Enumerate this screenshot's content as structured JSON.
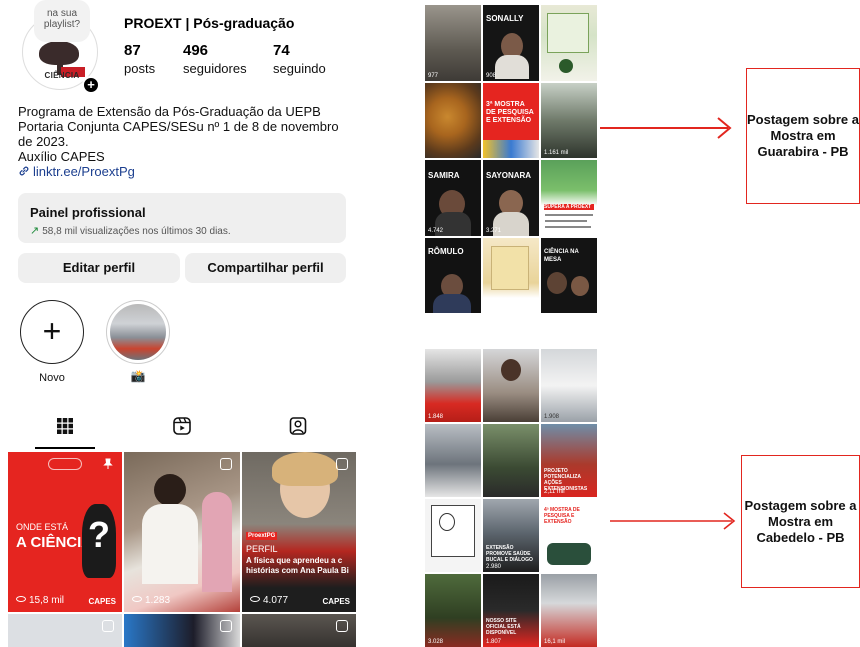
{
  "profile": {
    "username": "PROEXT | Pós-graduação",
    "note": "na sua playlist?",
    "logo_text": "CIÊNCIA",
    "stats": [
      {
        "value": "87",
        "label": "posts"
      },
      {
        "value": "496",
        "label": "seguidores"
      },
      {
        "value": "74",
        "label": "seguindo"
      }
    ],
    "bio": {
      "line1": "Programa de Extensão da Pós-Graduação da UEPB",
      "line2": "Portaria Conjunta CAPES/SESu nº 1 de 8 de novembro",
      "line3": "de 2023.",
      "line4": "Auxílio CAPES",
      "link": "linktr.ee/ProextPg"
    },
    "pro_panel": {
      "title": "Painel profissional",
      "subtitle": "58,8 mil visualizações nos últimos 30 dias."
    },
    "buttons": {
      "edit": "Editar perfil",
      "share": "Compartilhar perfil"
    },
    "highlights": [
      {
        "label": "Novo"
      },
      {
        "label": "📸"
      }
    ],
    "tabs": [
      "grid-icon",
      "reels-icon",
      "tagged-icon"
    ],
    "posts": [
      {
        "line1": "ONDE ESTÁ",
        "line2": "A CIÊNCIA",
        "mark": "?",
        "views": "15,8 mil",
        "capes": "CAPES"
      },
      {
        "views": "1.283"
      },
      {
        "tag": "ProextPG",
        "line1": "PERFIL",
        "line2": "A física que aprendeu a c",
        "line3": "histórias com Ana Paula Bi",
        "views": "4.077",
        "capes": "CAPES"
      }
    ]
  },
  "collage_top": {
    "cells": [
      {
        "text": "",
        "views": "977"
      },
      {
        "text": "SONALLY",
        "views": "908"
      },
      {
        "text": "",
        "views": ""
      },
      {
        "text": "",
        "views": ""
      },
      {
        "text": "3ª MOSTRA DE PESQUISA E EXTENSÃO",
        "views": ""
      },
      {
        "text": "",
        "views": "1.161 mil"
      },
      {
        "text": "SAMIRA",
        "views": "4.742"
      },
      {
        "text": "SAYONARA",
        "views": "3.271"
      },
      {
        "text": "SUPERA A PROEXT",
        "views": ""
      },
      {
        "text": "RÔMULO",
        "views": ""
      },
      {
        "text": "",
        "views": ""
      },
      {
        "text": "CIÊNCIA NA MESA",
        "views": ""
      }
    ]
  },
  "collage_bottom": {
    "cells": [
      {
        "text": "",
        "views": "1.848"
      },
      {
        "text": "",
        "views": ""
      },
      {
        "text": "",
        "views": "1.908"
      },
      {
        "text": "",
        "views": ""
      },
      {
        "text": "",
        "views": ""
      },
      {
        "text": "PROJETO POTENCIALIZA AÇÕES EXTENSIONISTAS",
        "views": "2,11 mil"
      },
      {
        "text": "",
        "views": ""
      },
      {
        "text": "EXTENSÃO PROMOVE SAÚDE BUCAL E DIÁLOGO",
        "views": "2.980"
      },
      {
        "text": "4ª MOSTRA DE PESQUISA E EXTENSÃO",
        "views": ""
      },
      {
        "text": "",
        "views": "3.028"
      },
      {
        "text": "NOSSO SITE OFICIAL ESTÁ DISPONÍVEL",
        "views": "1.807"
      },
      {
        "text": "",
        "views": "16,1 mil"
      }
    ]
  },
  "callouts": {
    "top": "Postagem sobre a Mostra em Guarabira - PB",
    "bottom": "Postagem sobre a Mostra em Cabedelo - PB"
  },
  "colors": {
    "accent_red": "#e2261f",
    "link_blue": "#1c3f8f",
    "panel_gray": "#efefef",
    "growth_green": "#1d8a3a"
  }
}
